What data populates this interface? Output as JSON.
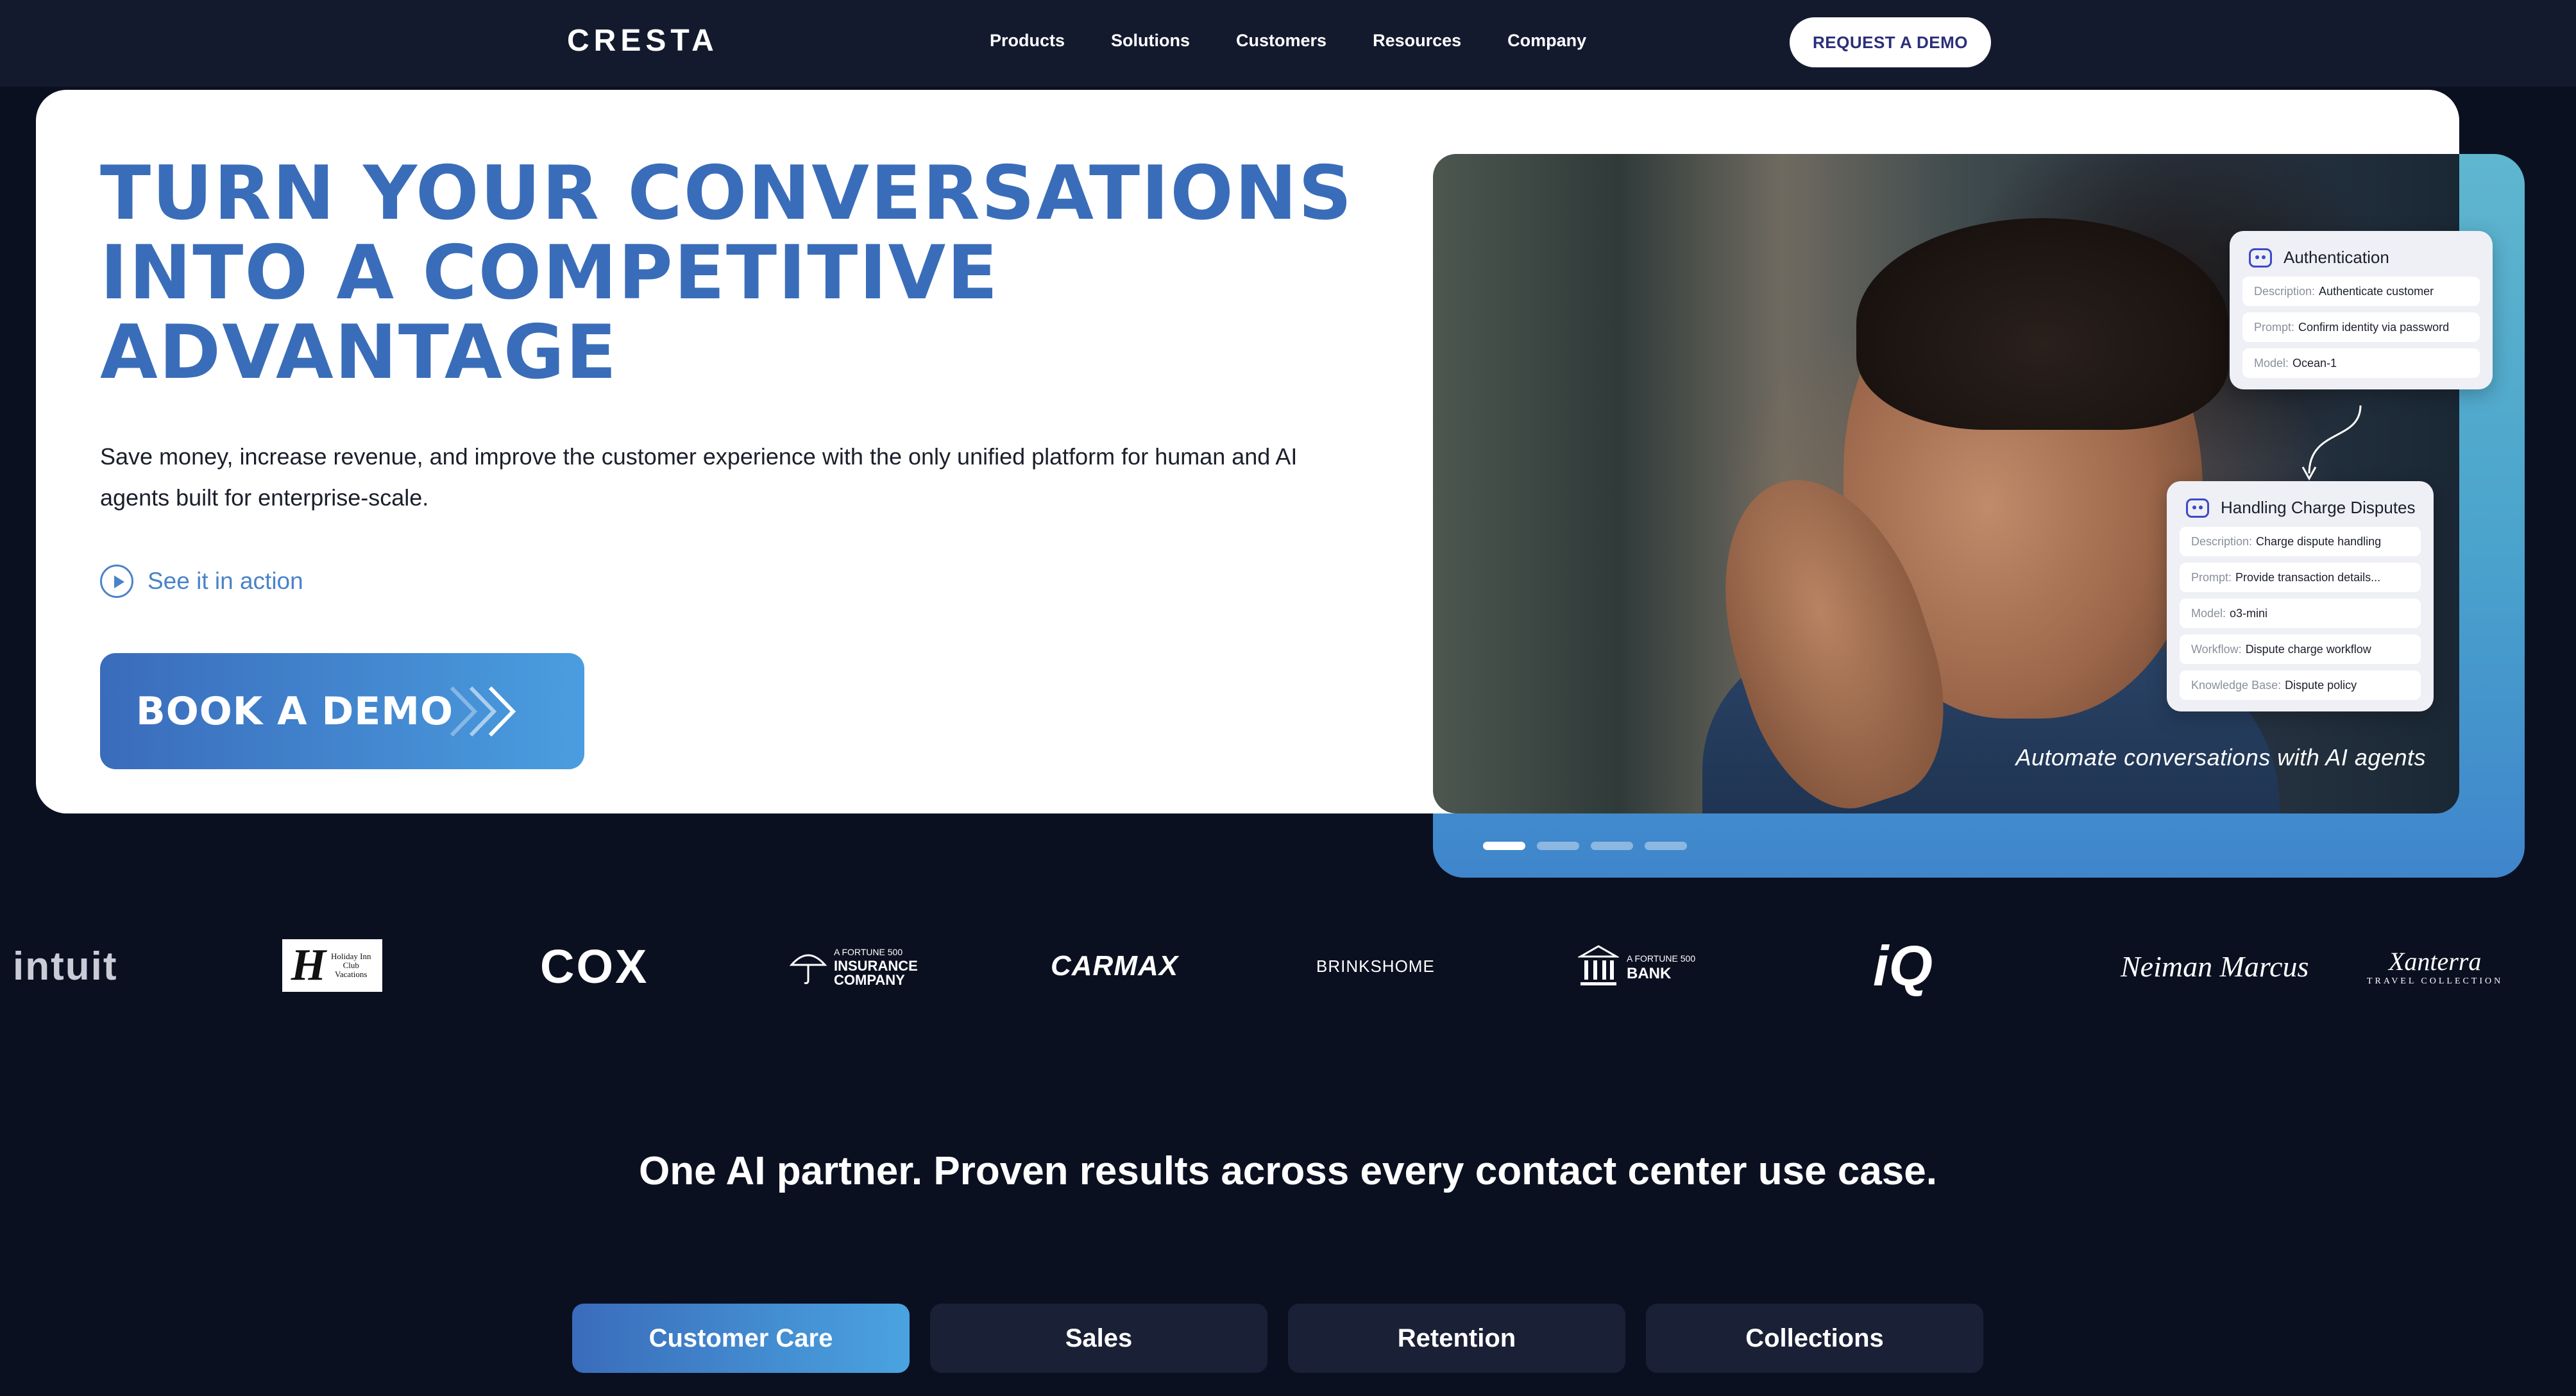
{
  "nav": {
    "logo": "CRESTA",
    "links": [
      "Products",
      "Solutions",
      "Customers",
      "Resources",
      "Company"
    ],
    "cta": "REQUEST A DEMO"
  },
  "hero": {
    "title": "TURN YOUR CONVERSATIONS INTO A COMPETITIVE ADVANTAGE",
    "subtitle": "Save money, increase revenue, and improve the customer experience with the only unified platform for human and AI agents built for enterprise-scale.",
    "see_action": "See it in action",
    "book_demo": "BOOK A DEMO",
    "caption": "Automate conversations with AI agents"
  },
  "agent_cards": {
    "auth": {
      "title": "Authentication",
      "rows": [
        {
          "k": "Description:",
          "v": "Authenticate customer"
        },
        {
          "k": "Prompt:",
          "v": "Confirm identity via password"
        },
        {
          "k": "Model:",
          "v": "Ocean-1"
        }
      ]
    },
    "dispute": {
      "title": "Handling Charge Disputes",
      "rows": [
        {
          "k": "Description:",
          "v": "Charge dispute handling"
        },
        {
          "k": "Prompt:",
          "v": "Provide transaction details..."
        },
        {
          "k": "Model:",
          "v": "o3-mini"
        },
        {
          "k": "Workflow:",
          "v": "Dispute charge workflow"
        },
        {
          "k": "Knowledge Base:",
          "v": "Dispute policy"
        }
      ]
    }
  },
  "carousel": {
    "count": 4,
    "active": 1
  },
  "logos": {
    "intuit": "intuit",
    "holiday": "Holiday Inn Club Vacations",
    "cox": "COX",
    "ins_small": "A FORTUNE 500",
    "ins_big": "INSURANCE COMPANY",
    "carmax": "CARMAX",
    "brinks": "BRINKSHOME",
    "bank_small": "A FORTUNE 500",
    "bank_big": "BANK",
    "iq": "iQ",
    "neiman": "Neiman Marcus",
    "xant_big": "Xanterra",
    "xant_small": "TRAVEL COLLECTION"
  },
  "section": {
    "title": "One AI partner. Proven results across every contact center use case.",
    "tabs": [
      "Customer Care",
      "Sales",
      "Retention",
      "Collections"
    ]
  }
}
